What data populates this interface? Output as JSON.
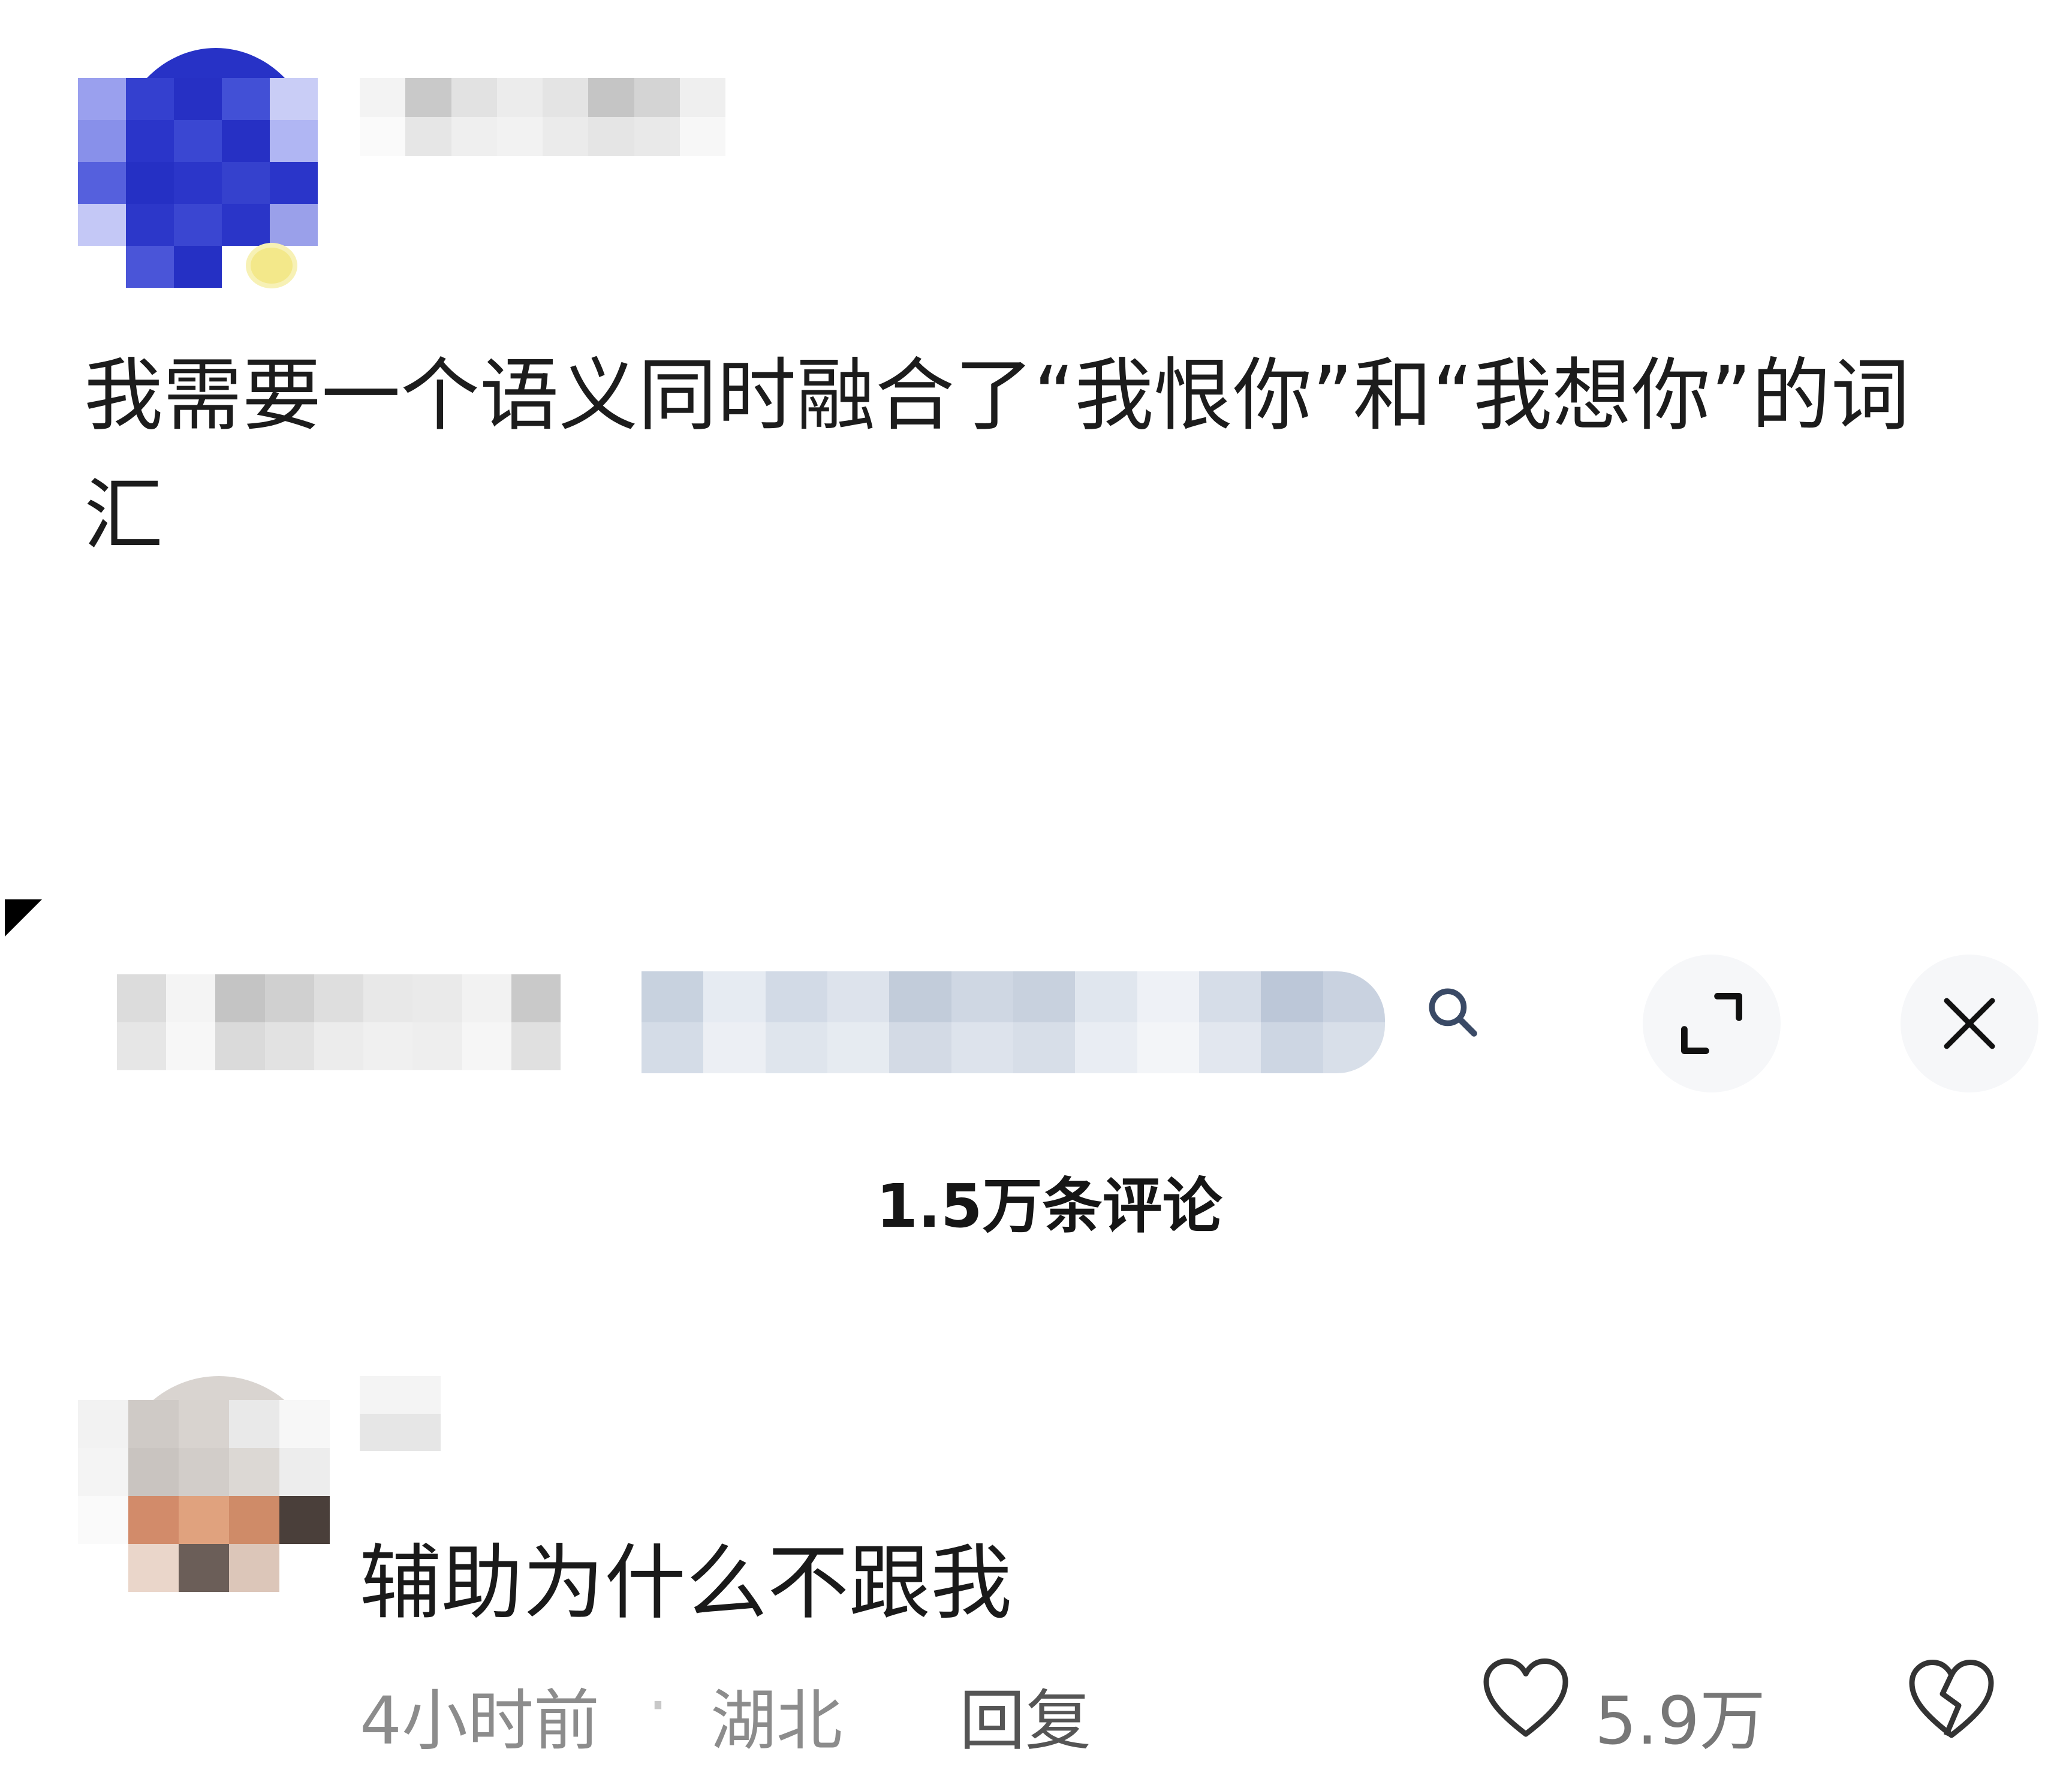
{
  "post": {
    "text": "我需要一个语义同时融合了“我恨你”和“我想你”的词汇"
  },
  "toolbar": {
    "search_icon": "search-icon",
    "expand_icon": "expand-icon",
    "close_icon": "close-icon"
  },
  "comments": {
    "count_label": "1.5万条评论"
  },
  "comment": {
    "text": "辅助为什么不跟我",
    "time": "4小时前",
    "separator": "·",
    "location": "湖北",
    "reply_label": "回复",
    "like_count": "5.9万",
    "like_icon": "heart-icon",
    "dislike_icon": "broken-heart-icon"
  },
  "colors": {
    "avatar_blue": "#2a37c8",
    "text": "#1a1a1a",
    "meta": "#8c8c8c"
  }
}
